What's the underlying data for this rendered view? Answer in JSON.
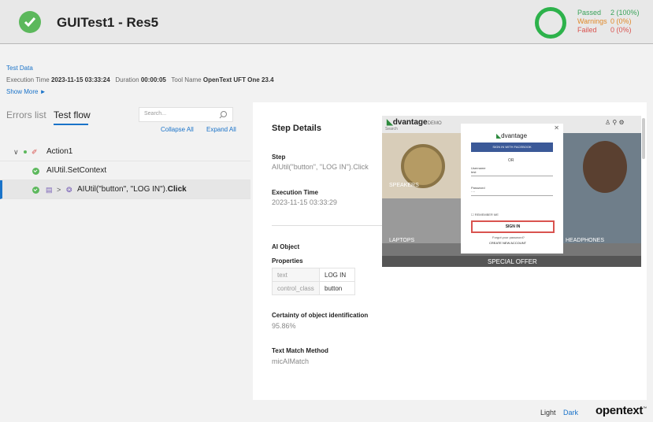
{
  "header": {
    "title": "GUITest1 - Res5",
    "status_icon": "check-circle-icon",
    "summary": {
      "passed_label": "Passed",
      "passed_value": "2 (100%)",
      "warnings_label": "Warnings",
      "warnings_value": "0   (0%)",
      "failed_label": "Failed",
      "failed_value": "0   (0%)"
    },
    "colors": {
      "passed": "#3aa35a",
      "warnings": "#e0892a",
      "failed": "#d9534f",
      "ring": "#2db24b"
    }
  },
  "meta": {
    "test_data": "Test Data",
    "exec_label": "Execution Time",
    "exec_value": "2023-11-15 03:33:24",
    "duration_label": "Duration",
    "duration_value": "00:00:05",
    "tool_label": "Tool Name",
    "tool_value": "OpenText UFT One 23.4",
    "show_more": "Show More ►"
  },
  "tabs": {
    "errors": "Errors list",
    "flow": "Test flow"
  },
  "search": {
    "placeholder": "Search..."
  },
  "tree_actions": {
    "collapse": "Collapse All",
    "expand": "Expand All"
  },
  "tree": {
    "action": "Action1",
    "step1": "AIUtil.SetContext",
    "step2_prefix": "AIUtil(\"button\", \"LOG IN\").",
    "step2_bold": "Click"
  },
  "details": {
    "title": "Step Details",
    "step_label": "Step",
    "step_value": "AIUtil(\"button\", \"LOG IN\").Click",
    "exec_label": "Execution Time",
    "exec_value": "2023-11-15 03:33:29",
    "ai_object_label": "AI Object",
    "properties_label": "Properties",
    "props": [
      {
        "key": "text",
        "value": "LOG IN"
      },
      {
        "key": "control_class",
        "value": "button"
      }
    ],
    "certainty_label": "Certainty of object identification",
    "certainty_value": "95.86%",
    "match_label": "Text Match Method",
    "match_value": "micAIMatch"
  },
  "screenshot": {
    "brand": "dvantage",
    "brand_suffix": "DEMO",
    "search": "Search",
    "speakers": "SPEAKERS",
    "laptops": "LAPTOPS",
    "headphones": "HEADPHONES",
    "special": "SPECIAL OFFER",
    "dialog": {
      "brand": "dvantage",
      "fb": "SIGN IN WITH FACEBOOK",
      "or": "OR",
      "username_label": "Username",
      "username_value": "test",
      "password_label": "Password",
      "password_value": "····",
      "remember": "REMEMBER ME",
      "signin": "SIGN IN",
      "forgot": "Forgot your password?",
      "create": "CREATE NEW ACCOUNT"
    }
  },
  "footer": {
    "light": "Light",
    "dark": "Dark",
    "logo": "opentext",
    "logo_tm": "™"
  }
}
